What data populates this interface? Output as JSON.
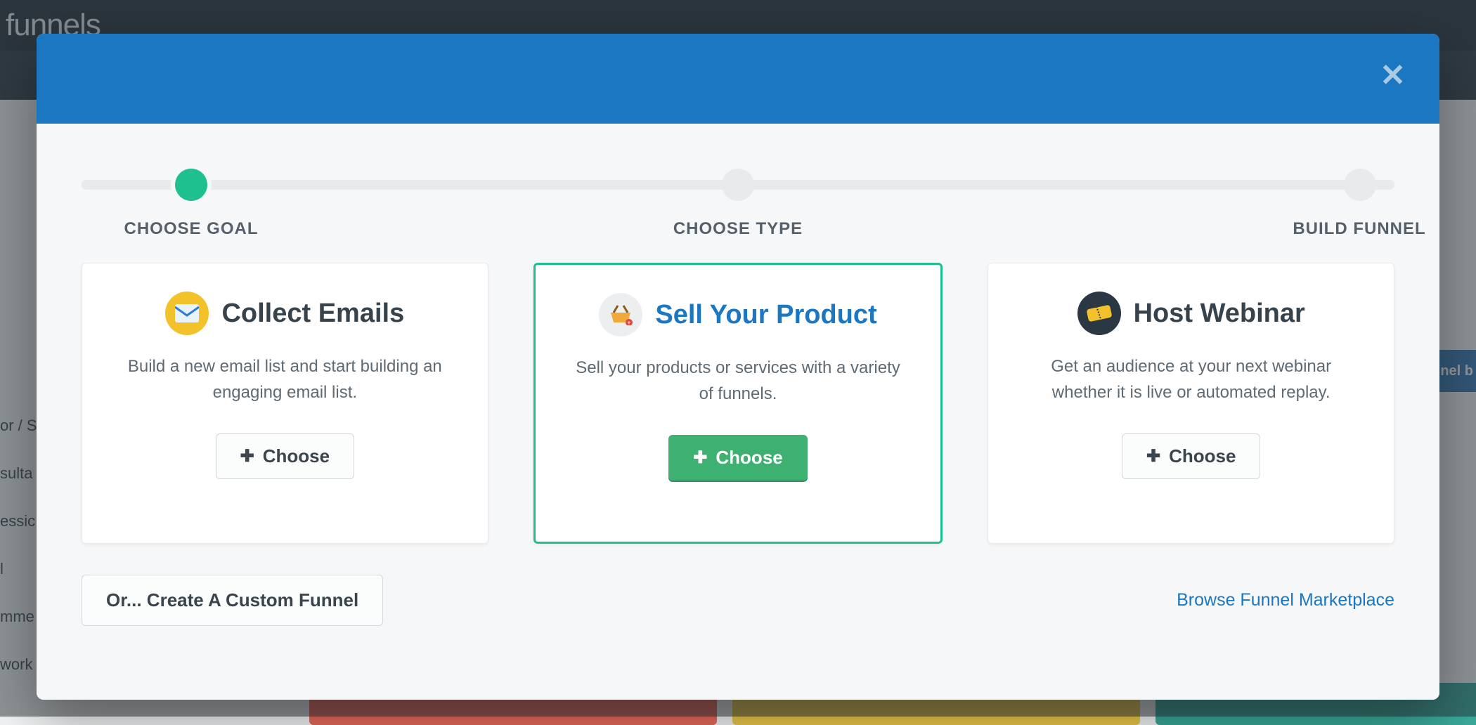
{
  "brand": "funnels",
  "bg_right_badge": "nel b",
  "bg_side_items": [
    "or / S",
    "sulta",
    "essic",
    "l",
    "mme",
    "work Marketing"
  ],
  "modal": {
    "steps": [
      {
        "label": "CHOOSE GOAL",
        "active": true
      },
      {
        "label": "CHOOSE TYPE",
        "active": false
      },
      {
        "label": "BUILD FUNNEL",
        "active": false
      }
    ],
    "cards": [
      {
        "title": "Collect Emails",
        "desc": "Build a new email list and start building an engaging email list.",
        "button": "Choose",
        "selected": false,
        "icon": "envelope-icon",
        "icon_bg": "#f3c22a",
        "icon_fg": "#2a7fd4"
      },
      {
        "title": "Sell Your Product",
        "desc": "Sell your products or services with a variety of funnels.",
        "button": "Choose",
        "selected": true,
        "icon": "basket-icon",
        "icon_bg": "#edeef0",
        "icon_fg": "#f2a93b"
      },
      {
        "title": "Host Webinar",
        "desc": "Get an audience at your next webinar whether it is live or automated replay.",
        "button": "Choose",
        "selected": false,
        "icon": "ticket-icon",
        "icon_bg": "#2b3844",
        "icon_fg": "#f3c22a"
      }
    ],
    "custom_button": "Or... Create A Custom Funnel",
    "browse_link": "Browse Funnel Marketplace"
  }
}
